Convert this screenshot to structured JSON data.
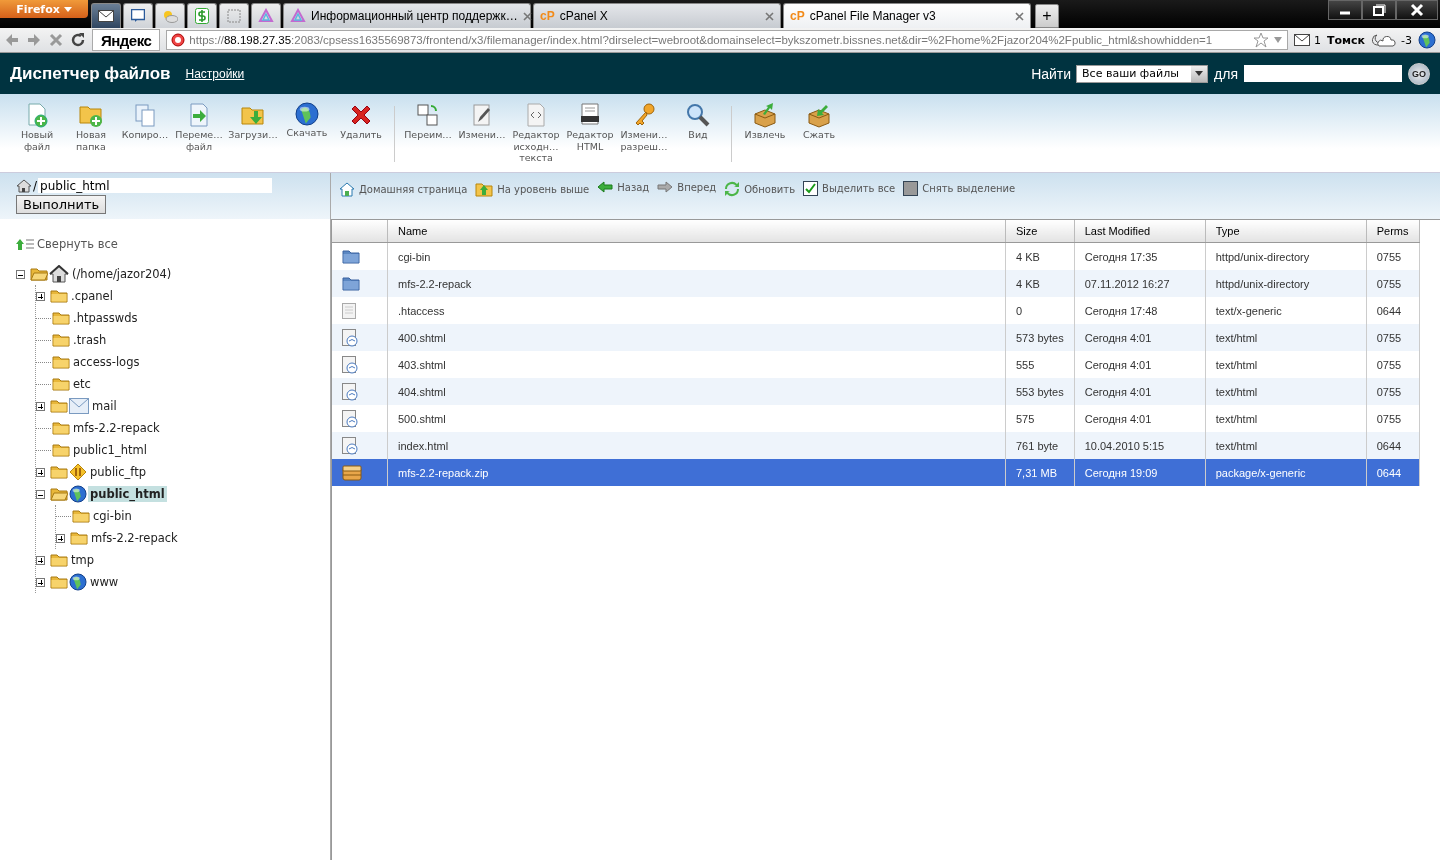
{
  "browser": {
    "menu_button": "Firefox",
    "pinned_tabs": [
      {
        "selected": true
      },
      {
        "selected": false
      },
      {
        "selected": false
      },
      {
        "selected": false
      },
      {
        "selected": false
      },
      {
        "selected": false
      }
    ],
    "tabs": [
      {
        "title": "Информационный центр поддержк…",
        "selected": false
      },
      {
        "title": "cPanel X",
        "logo": "cP",
        "selected": false
      },
      {
        "title": "cPanel File Manager v3",
        "logo": "cP",
        "selected": true
      }
    ],
    "new_tab": "+",
    "search_engine": "Яндекс",
    "url": {
      "scheme": "https://",
      "host": "88.198.27.35",
      "rest": ":2083/cpsess1635569873/frontend/x3/filemanager/index.html?dirselect=webroot&domainselect=bykszometr.bissnes.net&dir=%2Fhome%2Fjazor204%2Fpublic_html&showhidden=1"
    },
    "mail_count": "1",
    "city": "Томск",
    "temperature": "-3"
  },
  "header": {
    "title": "Диспетчер файлов",
    "settings_link": "Настройки",
    "search_label": "Найти",
    "scope": "Все ваши файлы",
    "for_label": "для",
    "go": "GO"
  },
  "toolbar": {
    "groups": [
      [
        {
          "label": "Новый\nфайл"
        },
        {
          "label": "Новая\nпапка"
        },
        {
          "label": "Копиро…"
        },
        {
          "label": "Переме…\nфайл"
        },
        {
          "label": "Загрузи…"
        },
        {
          "label": "Скачать"
        },
        {
          "label": "Удалить"
        }
      ],
      [
        {
          "label": "Переим…"
        },
        {
          "label": "Измени…"
        },
        {
          "label": "Редактор\nисходн…\nтекста"
        },
        {
          "label": "Редактор\nHTML"
        },
        {
          "label": "Измени…\nразреш…"
        },
        {
          "label": "Вид"
        }
      ],
      [
        {
          "label": "Извлечь"
        },
        {
          "label": "Сжать"
        }
      ]
    ]
  },
  "path": {
    "separator": "/",
    "value": "public_html",
    "go_button": "Выполнить"
  },
  "navigation": [
    {
      "label": "Домашняя страница"
    },
    {
      "label": "На уровень выше"
    },
    {
      "label": "Назад"
    },
    {
      "label": "Вперед"
    },
    {
      "label": "Обновить"
    },
    {
      "label": "Выделить все"
    },
    {
      "label": "Снять выделение"
    }
  ],
  "tree": {
    "collapse_all": "Свернуть все",
    "root": {
      "kind": "home",
      "label": "(/home/jazor204)",
      "expanded": true,
      "selected": false,
      "children": [
        {
          "label": ".cpanel",
          "expanded": false,
          "selected": false
        },
        {
          "label": ".htpasswds",
          "selected": false
        },
        {
          "label": ".trash",
          "selected": false
        },
        {
          "label": "access-logs",
          "selected": false
        },
        {
          "label": "etc",
          "selected": false
        },
        {
          "kind": "mail",
          "label": "mail",
          "expanded": false,
          "selected": false
        },
        {
          "label": "mfs-2.2-repack",
          "selected": false
        },
        {
          "label": "public1_html",
          "selected": false
        },
        {
          "kind": "ftp",
          "label": "public_ftp",
          "expanded": false,
          "selected": false
        },
        {
          "kind": "web",
          "label": "public_html",
          "expanded": true,
          "selected": true,
          "children": [
            {
              "label": "cgi-bin",
              "selected": false
            },
            {
              "label": "mfs-2.2-repack",
              "expanded": false,
              "selected": false
            }
          ]
        },
        {
          "label": "tmp",
          "expanded": false,
          "selected": false
        },
        {
          "kind": "web",
          "label": "www",
          "expanded": false,
          "selected": false
        }
      ]
    }
  },
  "table": {
    "columns": [
      "Name",
      "Size",
      "Last Modified",
      "Type",
      "Perms"
    ],
    "rows": [
      {
        "kind": "directory",
        "name": "cgi-bin",
        "size": "4 KB",
        "modified": "Сегодня 17:35",
        "type": "httpd/unix-directory",
        "perms": "0755",
        "selected": false
      },
      {
        "kind": "directory",
        "name": "mfs-2.2-repack",
        "size": "4 KB",
        "modified": "07.11.2012 16:27",
        "type": "httpd/unix-directory",
        "perms": "0755",
        "selected": false
      },
      {
        "kind": "file",
        "name": ".htaccess",
        "size": "0",
        "modified": "Сегодня 17:48",
        "type": "text/x-generic",
        "perms": "0644",
        "selected": false
      },
      {
        "kind": "html",
        "name": "400.shtml",
        "size": "573 bytes",
        "modified": "Сегодня 4:01",
        "type": "text/html",
        "perms": "0755",
        "selected": false
      },
      {
        "kind": "html",
        "name": "403.shtml",
        "size": "555",
        "modified": "Сегодня 4:01",
        "type": "text/html",
        "perms": "0755",
        "selected": false
      },
      {
        "kind": "html",
        "name": "404.shtml",
        "size": "553 bytes",
        "modified": "Сегодня 4:01",
        "type": "text/html",
        "perms": "0755",
        "selected": false
      },
      {
        "kind": "html",
        "name": "500.shtml",
        "size": "575",
        "modified": "Сегодня 4:01",
        "type": "text/html",
        "perms": "0755",
        "selected": false
      },
      {
        "kind": "html",
        "name": "index.html",
        "size": "761 byte",
        "modified": "10.04.2010 5:15",
        "type": "text/html",
        "perms": "0644",
        "selected": false
      },
      {
        "kind": "archive",
        "name": "mfs-2.2-repack.zip",
        "size": "7,31 MB",
        "modified": "Сегодня 19:09",
        "type": "package/x-generic",
        "perms": "0644",
        "selected": true
      }
    ]
  }
}
